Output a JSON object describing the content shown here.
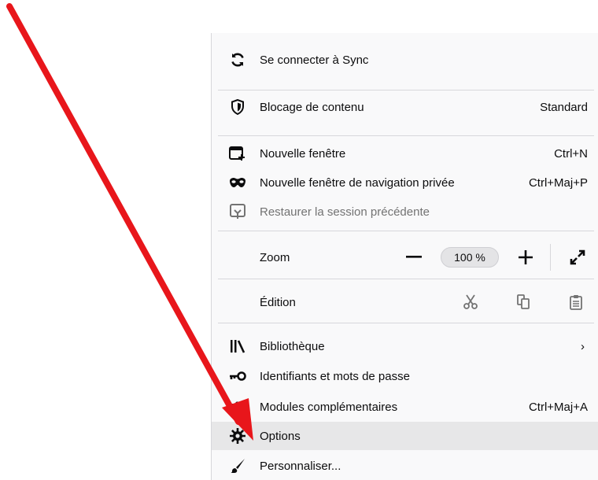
{
  "menu": {
    "sync": {
      "label": "Se connecter à Sync",
      "icon": "sync-icon"
    },
    "content_blocking": {
      "label": "Blocage de contenu",
      "value": "Standard",
      "icon": "shield-icon"
    },
    "new_window": {
      "label": "Nouvelle fenêtre",
      "shortcut": "Ctrl+N",
      "icon": "new-window-icon"
    },
    "private_window": {
      "label": "Nouvelle fenêtre de navigation privée",
      "shortcut": "Ctrl+Maj+P",
      "icon": "private-mask-icon"
    },
    "restore_session": {
      "label": "Restaurer la session précédente",
      "icon": "restore-session-icon",
      "disabled": true
    },
    "zoom": {
      "label": "Zoom",
      "minus": "−",
      "value": "100 %",
      "plus": "+"
    },
    "edit": {
      "label": "Édition",
      "cut_icon": "scissors-icon",
      "copy_icon": "copy-icon",
      "paste_icon": "clipboard-icon"
    },
    "library": {
      "label": "Bibliothèque",
      "chevron": "›",
      "icon": "library-icon"
    },
    "logins": {
      "label": "Identifiants et mots de passe",
      "icon": "key-icon"
    },
    "addons": {
      "label": "Modules complémentaires",
      "shortcut": "Ctrl+Maj+A",
      "icon": "puzzle-icon"
    },
    "options": {
      "label": "Options",
      "icon": "gear-icon",
      "highlighted": true
    },
    "customize": {
      "label": "Personnaliser...",
      "icon": "paintbrush-icon"
    }
  },
  "annotation": {
    "arrow_color": "#e8161b"
  }
}
